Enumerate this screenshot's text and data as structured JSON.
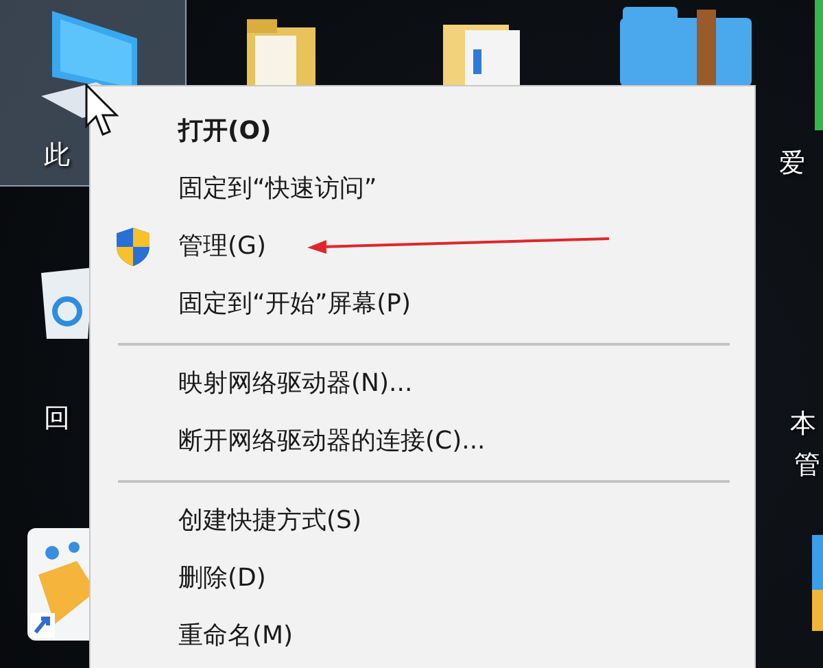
{
  "desktop": {
    "icons": [
      {
        "kind": "computer",
        "selected": true,
        "labels": [
          "此"
        ]
      },
      {
        "kind": "folder",
        "selected": false
      },
      {
        "kind": "document_folder",
        "selected": false
      },
      {
        "kind": "archive_folder",
        "selected": false
      },
      {
        "kind": "green_app",
        "selected": false
      },
      {
        "kind": "label_only",
        "selected": false,
        "labels": [
          "爱"
        ]
      },
      {
        "kind": "recycle_bin",
        "selected": false,
        "labels": [
          "回"
        ]
      },
      {
        "kind": "label_only",
        "selected": false,
        "labels": [
          "本",
          "管"
        ]
      },
      {
        "kind": "app",
        "selected": false
      },
      {
        "kind": "side_app",
        "selected": false
      }
    ]
  },
  "context_menu": {
    "items": [
      {
        "kind": "item",
        "label": "打开(O)",
        "default": true,
        "pointed": false
      },
      {
        "kind": "item",
        "label": "固定到“快速访问”",
        "default": false,
        "pointed": false
      },
      {
        "kind": "shield_item",
        "label": "管理(G)",
        "default": false,
        "pointed": true
      },
      {
        "kind": "item",
        "label": "固定到“开始”屏幕(P)",
        "default": false,
        "pointed": false
      },
      {
        "kind": "separator"
      },
      {
        "kind": "item",
        "label": "映射网络驱动器(N)...",
        "default": false,
        "pointed": false
      },
      {
        "kind": "item",
        "label": "断开网络驱动器的连接(C)...",
        "default": false,
        "pointed": false
      },
      {
        "kind": "separator"
      },
      {
        "kind": "item",
        "label": "创建快捷方式(S)",
        "default": false,
        "pointed": false
      },
      {
        "kind": "item",
        "label": "删除(D)",
        "default": false,
        "pointed": false
      },
      {
        "kind": "item",
        "label": "重命名(M)",
        "default": false,
        "pointed": false
      }
    ]
  }
}
